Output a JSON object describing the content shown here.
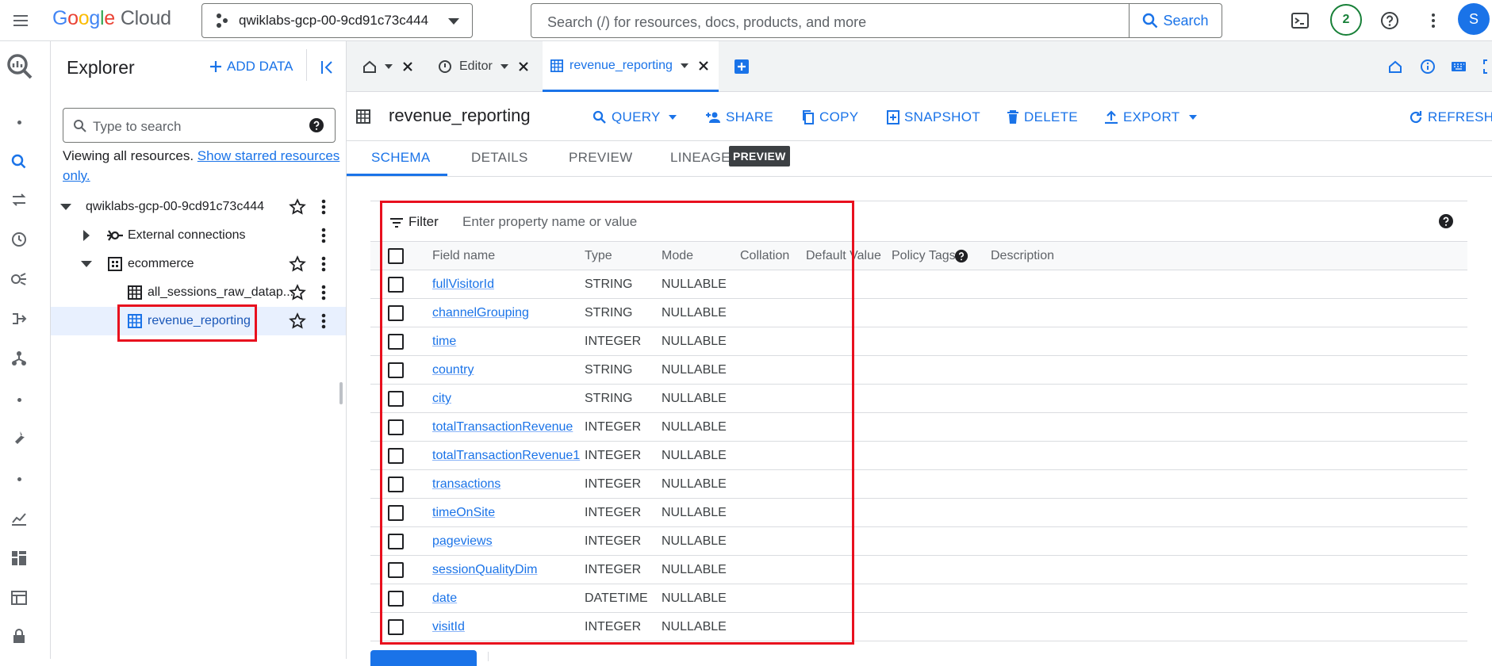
{
  "topbar": {
    "logo_letters": [
      "G",
      "o",
      "o",
      "g",
      "l",
      "e"
    ],
    "logo_cloud": "Cloud",
    "project": "qwiklabs-gcp-00-9cd91c73c444",
    "search_placeholder": "Search (/) for resources, docs, products, and more",
    "search_button": "Search",
    "notifications_count": "2",
    "avatar_initial": "S",
    "colors": {
      "accent": "#1a73e8",
      "badge": "#188038"
    }
  },
  "explorer": {
    "title": "Explorer",
    "add_data": "ADD DATA",
    "search_placeholder": "Type to search",
    "viewing_text": "Viewing all resources.",
    "viewing_link": "Show starred resources only.",
    "tree": [
      {
        "label": "qwiklabs-gcp-00-9cd91c73c444",
        "level": 0,
        "expanded": true
      },
      {
        "label": "External connections",
        "level": 1,
        "expanded": false
      },
      {
        "label": "ecommerce",
        "level": 1,
        "expanded": true
      },
      {
        "label": "all_sessions_raw_datap...",
        "level": 2
      },
      {
        "label": "revenue_reporting",
        "level": 2,
        "selected": true
      }
    ]
  },
  "tabs": [
    {
      "label": "",
      "icon": "home-icon"
    },
    {
      "label": "Editor",
      "icon": "query-icon"
    },
    {
      "label": "revenue_reporting",
      "icon": "table-icon",
      "active": true
    }
  ],
  "table_toolbar": {
    "title": "revenue_reporting",
    "actions": {
      "query": "QUERY",
      "share": "SHARE",
      "copy": "COPY",
      "snapshot": "SNAPSHOT",
      "delete": "DELETE",
      "export": "EXPORT",
      "refresh": "REFRESH"
    }
  },
  "subtabs": {
    "schema": "SCHEMA",
    "details": "DETAILS",
    "preview": "PREVIEW",
    "lineage": "LINEAGE",
    "lineage_badge": "PREVIEW"
  },
  "schema": {
    "filter_label": "Filter",
    "filter_placeholder": "Enter property name or value",
    "columns": {
      "field_name": "Field name",
      "type": "Type",
      "mode": "Mode",
      "collation": "Collation",
      "default_value": "Default Value",
      "policy_tags": "Policy Tags",
      "description": "Description"
    },
    "rows": [
      {
        "name": "fullVisitorId",
        "type": "STRING",
        "mode": "NULLABLE"
      },
      {
        "name": "channelGrouping",
        "type": "STRING",
        "mode": "NULLABLE"
      },
      {
        "name": "time",
        "type": "INTEGER",
        "mode": "NULLABLE"
      },
      {
        "name": "country",
        "type": "STRING",
        "mode": "NULLABLE"
      },
      {
        "name": "city",
        "type": "STRING",
        "mode": "NULLABLE"
      },
      {
        "name": "totalTransactionRevenue",
        "type": "INTEGER",
        "mode": "NULLABLE"
      },
      {
        "name": "totalTransactionRevenue1",
        "type": "INTEGER",
        "mode": "NULLABLE"
      },
      {
        "name": "transactions",
        "type": "INTEGER",
        "mode": "NULLABLE"
      },
      {
        "name": "timeOnSite",
        "type": "INTEGER",
        "mode": "NULLABLE"
      },
      {
        "name": "pageviews",
        "type": "INTEGER",
        "mode": "NULLABLE"
      },
      {
        "name": "sessionQualityDim",
        "type": "INTEGER",
        "mode": "NULLABLE"
      },
      {
        "name": "date",
        "type": "DATETIME",
        "mode": "NULLABLE"
      },
      {
        "name": "visitId",
        "type": "INTEGER",
        "mode": "NULLABLE"
      }
    ]
  }
}
